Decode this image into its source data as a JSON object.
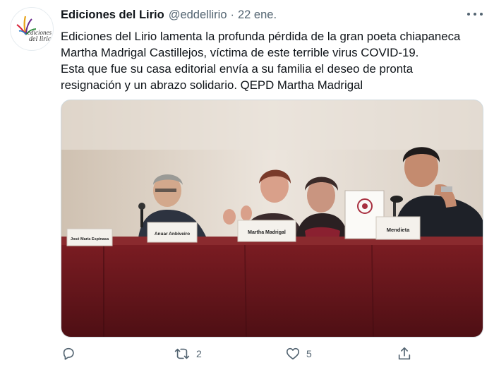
{
  "account": {
    "name": "Ediciones del Lirio",
    "handle": "@eddellirio",
    "separator": "·",
    "date": "22 ene.",
    "logo_text_line1": "ediciones",
    "logo_text_line2": "del lirio"
  },
  "tweet": {
    "lines": [
      "Ediciones del Lirio lamenta la profunda pérdida de la gran poeta chiapaneca",
      "Martha Madrigal Castillejos, víctima de este terrible virus COVID-19.",
      "Esta que fue su casa editorial envía a su familia el deseo de pronta",
      "resignación y un abrazo solidario. QEPD Martha Madrigal"
    ]
  },
  "photo": {
    "placards": [
      "José María Espinasa",
      "Anuar Anbiveiro",
      "Martha Madrigal",
      "Mendieta"
    ]
  },
  "actions": {
    "reply": "",
    "retweet_count": "2",
    "like_count": "5",
    "share": ""
  },
  "colors": {
    "secondary_text": "#536471",
    "table_cloth": "#6b1a1e",
    "wall": "#e6ddd3"
  }
}
